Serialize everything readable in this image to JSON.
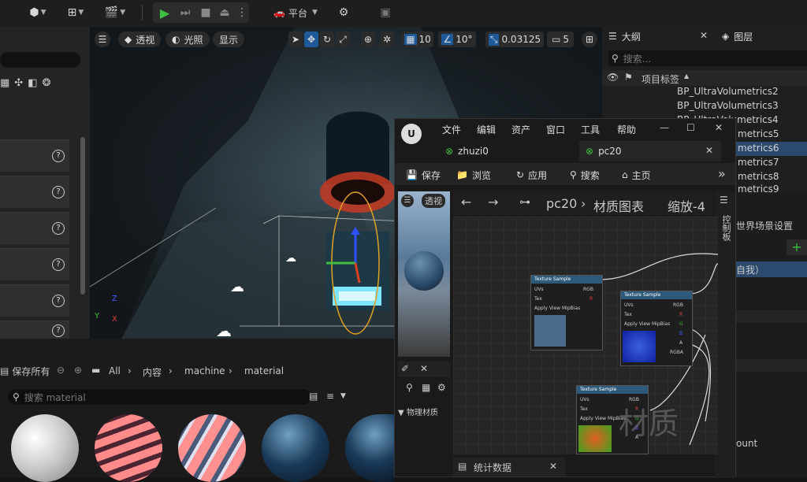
{
  "toolbar": {
    "platform_label": "平台",
    "icons": [
      "add-actor-icon",
      "modes-icon",
      "cinematics-icon",
      "play-icon",
      "step-icon",
      "stop-icon",
      "eject-icon",
      "platform-icon",
      "settings-icon",
      "save-icon"
    ]
  },
  "viewport": {
    "perspective": "透视",
    "lighting": "光照",
    "show": "显示",
    "grid_snap": "10",
    "rot_snap": "10°",
    "scale_snap": "0.03125",
    "cam_speed": "5",
    "axis_x": "X",
    "axis_z": "Z",
    "axis_y": "Y"
  },
  "outliner": {
    "tab_outline": "大纲",
    "tab_layers": "图层",
    "search_placeholder": "搜索...",
    "column_label": "项目标签",
    "items": [
      "BP_UltraVolumetrics2",
      "BP_UltraVolumetrics3",
      "BP_UltraVolumetrics4",
      "metrics5",
      "metrics6",
      "metrics7",
      "metrics8",
      "metrics9"
    ]
  },
  "details": {
    "world_settings": "世界场景设置",
    "selected": "自我）",
    "amount": "ount"
  },
  "content_browser": {
    "save_all": "保存所有",
    "path": [
      "All",
      "内容",
      "machine",
      "material"
    ],
    "search_placeholder": "搜索 material"
  },
  "material_editor": {
    "menu": [
      "文件",
      "编辑",
      "资产",
      "窗口",
      "工具",
      "帮助"
    ],
    "tabs": [
      "zhuzi0",
      "pc20"
    ],
    "toolbar": [
      "保存",
      "浏览",
      "应用",
      "搜索",
      "主页"
    ],
    "preview_mode": "透视",
    "breadcrumb_root": "pc20",
    "breadcrumb_child": "材质图表",
    "zoom": "缩放-4",
    "side_tab": "控制板",
    "physics_material": "物理材质",
    "stats": "统计数据",
    "watermark": "材质",
    "node_title": "Texture Sample",
    "pins_in": [
      "UVs",
      "Tex",
      "Apply View MipBias"
    ],
    "pins_out": [
      "RGB",
      "R",
      "G",
      "B",
      "A",
      "RGBA"
    ]
  }
}
